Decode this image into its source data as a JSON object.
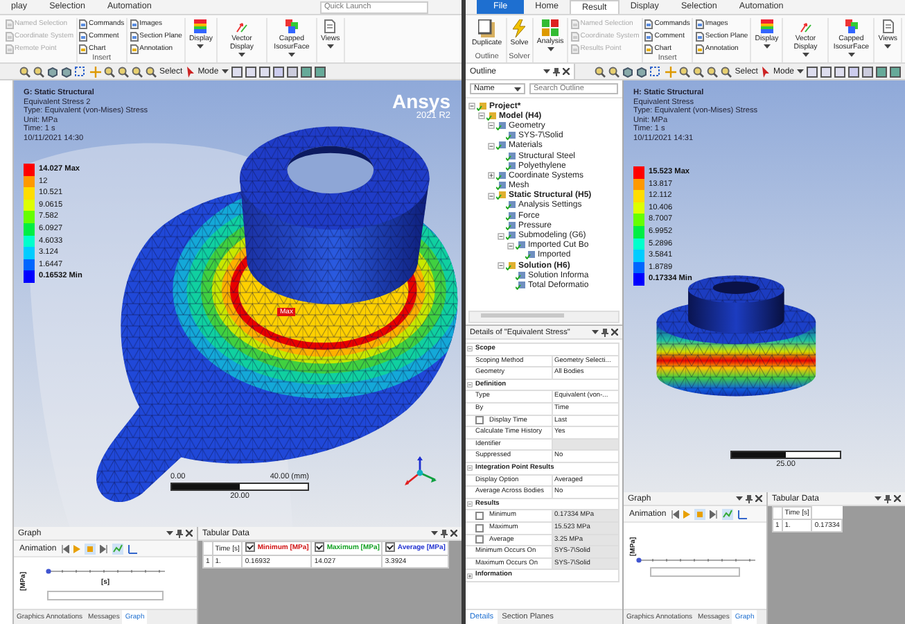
{
  "left_window": {
    "tabs": [
      {
        "label": "play",
        "kind": "tab",
        "selected": false
      },
      {
        "label": "Selection",
        "kind": "tab",
        "selected": false
      },
      {
        "label": "Automation",
        "kind": "tab",
        "selected": false
      }
    ],
    "quick_launch": {
      "placeholder": "Quick Launch"
    },
    "ribbon": [
      {
        "kind": "stack",
        "items": [
          {
            "label": "Named Selection",
            "disabled": true
          },
          {
            "label": "Coordinate System",
            "disabled": true
          },
          {
            "label": "Remote Point",
            "disabled": true
          }
        ]
      },
      {
        "kind": "stack",
        "group": "Insert",
        "items": [
          {
            "label": "Commands",
            "disabled": false
          },
          {
            "label": "Comment",
            "disabled": false
          },
          {
            "label": "Chart",
            "disabled": false
          }
        ]
      },
      {
        "kind": "stack",
        "items": [
          {
            "label": "Images",
            "disabled": false
          },
          {
            "label": "Section Plane",
            "disabled": false
          },
          {
            "label": "Annotation",
            "disabled": false
          }
        ]
      },
      {
        "kind": "contour",
        "label": "Display"
      },
      {
        "kind": "vector",
        "label": "Vector Display"
      },
      {
        "kind": "capped",
        "label": "Capped IsosurFace"
      },
      {
        "kind": "views",
        "label": "Views"
      }
    ],
    "toolbar": {
      "select": "Select",
      "mode": "Mode"
    },
    "viewport": {
      "kind": "flange",
      "header": [
        "G: Static Structural",
        "Equivalent Stress 2",
        "Type: Equivalent (von-Mises) Stress",
        "Unit: MPa",
        "Time: 1 s",
        "10/11/2021 14:30"
      ],
      "legend": [
        {
          "value": "14.027 Max",
          "color": "#ff0000"
        },
        {
          "value": "12",
          "color": "#ff9900"
        },
        {
          "value": "10.521",
          "color": "#ffdd00"
        },
        {
          "value": "9.0615",
          "color": "#ddff00"
        },
        {
          "value": "7.582",
          "color": "#66ff00"
        },
        {
          "value": "6.0927",
          "color": "#00ee44"
        },
        {
          "value": "4.6033",
          "color": "#00ffcc"
        },
        {
          "value": "3.124",
          "color": "#00ccff"
        },
        {
          "value": "1.6447",
          "color": "#0066ff"
        },
        {
          "value": "0.16532 Min",
          "color": "#0000ff"
        }
      ],
      "logo": {
        "name": "Ansys",
        "version": "2021 R2"
      },
      "max_label": "Max",
      "scale": {
        "start": "0.00",
        "end": "40.00 (mm)",
        "middle": "20.00"
      },
      "triad": true
    },
    "graph": {
      "title": "Graph",
      "animation": "Animation",
      "y_unit": "[MPa]",
      "x_unit": "[s]",
      "tabs": [
        {
          "label": "Graphics Annotations",
          "selected": false
        },
        {
          "label": "Messages",
          "selected": false
        },
        {
          "label": "Graph",
          "selected": true
        }
      ]
    },
    "tabular": {
      "title": "Tabular Data",
      "columns": [
        {
          "kind": "plain",
          "label": "Time [s]"
        },
        {
          "kind": "series",
          "label": "Minimum [MPa]",
          "checked": true,
          "color": "#d01010"
        },
        {
          "kind": "series",
          "label": "Maximum [MPa]",
          "checked": true,
          "color": "#10a020"
        },
        {
          "kind": "series",
          "label": "Average [MPa]",
          "checked": true,
          "color": "#2030d0"
        }
      ],
      "rows": [
        {
          "index": "1",
          "cells": [
            "1.",
            "0.16932",
            "14.027",
            "3.3924"
          ]
        }
      ]
    }
  },
  "right_window": {
    "tabs": [
      {
        "label": "File",
        "kind": "file",
        "selected": false
      },
      {
        "label": "Home",
        "kind": "tab",
        "selected": false
      },
      {
        "label": "Result",
        "kind": "tab",
        "selected": true
      },
      {
        "label": "Display",
        "kind": "tab",
        "selected": false
      },
      {
        "label": "Selection",
        "kind": "tab",
        "selected": false
      },
      {
        "label": "Automation",
        "kind": "tab",
        "selected": false
      }
    ],
    "ribbon": [
      {
        "kind": "duplicate",
        "label": "Duplicate",
        "group": "Outline"
      },
      {
        "kind": "solve",
        "label": "Solve",
        "group": "Solver"
      },
      {
        "kind": "analysis",
        "label": "Analysis"
      },
      {
        "kind": "stack",
        "items": [
          {
            "label": "Named Selection",
            "disabled": true
          },
          {
            "label": "Coordinate System",
            "disabled": true
          },
          {
            "label": "Results Point",
            "disabled": true
          }
        ]
      },
      {
        "kind": "stack",
        "group": "Insert",
        "items": [
          {
            "label": "Commands",
            "disabled": false
          },
          {
            "label": "Comment",
            "disabled": false
          },
          {
            "label": "Chart",
            "disabled": false
          }
        ]
      },
      {
        "kind": "stack",
        "items": [
          {
            "label": "Images",
            "disabled": false
          },
          {
            "label": "Section Plane",
            "disabled": false
          },
          {
            "label": "Annotation",
            "disabled": false
          }
        ]
      },
      {
        "kind": "contour",
        "label": "Display"
      },
      {
        "kind": "vector",
        "label": "Vector Display"
      },
      {
        "kind": "capped",
        "label": "Capped IsosurFace"
      },
      {
        "kind": "views",
        "label": "Views"
      }
    ],
    "toolbar": {
      "outline_title": "Outline",
      "select": "Select",
      "mode": "Mode"
    },
    "outline": {
      "sort": "Name",
      "search": {
        "placeholder": "Search Outline"
      },
      "tree": [
        {
          "label": "Project*",
          "bold": true,
          "expanded": true,
          "children": [
            {
              "label": "Model (H4)",
              "bold": true,
              "expanded": true,
              "children": [
                {
                  "label": "Geometry",
                  "bold": false,
                  "expanded": true,
                  "children": [
                    {
                      "label": "SYS-7\\Solid",
                      "bold": false
                    }
                  ]
                },
                {
                  "label": "Materials",
                  "bold": false,
                  "expanded": true,
                  "children": [
                    {
                      "label": "Structural Steel",
                      "bold": false
                    },
                    {
                      "label": "Polyethylene",
                      "bold": false
                    }
                  ]
                },
                {
                  "label": "Coordinate Systems",
                  "bold": false,
                  "expanded": false
                },
                {
                  "label": "Mesh",
                  "bold": false
                },
                {
                  "label": "Static Structural (H5)",
                  "bold": true,
                  "expanded": true,
                  "children": [
                    {
                      "label": "Analysis Settings",
                      "bold": false
                    },
                    {
                      "label": "Force",
                      "bold": false
                    },
                    {
                      "label": "Pressure",
                      "bold": false
                    },
                    {
                      "label": "Submodeling (G6)",
                      "bold": false,
                      "expanded": true,
                      "children": [
                        {
                          "label": "Imported Cut Bo",
                          "bold": false,
                          "expanded": true,
                          "children": [
                            {
                              "label": "Imported",
                              "bold": false
                            }
                          ]
                        }
                      ]
                    },
                    {
                      "label": "Solution (H6)",
                      "bold": true,
                      "expanded": true,
                      "children": [
                        {
                          "label": "Solution Informa",
                          "bold": false
                        },
                        {
                          "label": "Total Deformatio",
                          "bold": false
                        }
                      ]
                    }
                  ]
                }
              ]
            }
          ]
        }
      ]
    },
    "details": {
      "title": "Details of \"Equivalent Stress\"",
      "rows": [
        {
          "kind": "section",
          "label": "Scope",
          "expanded": true
        },
        {
          "kind": "property",
          "label": "Scoping Method",
          "value": "Geometry Selecti...",
          "readonly": false
        },
        {
          "kind": "property",
          "label": "Geometry",
          "value": "All Bodies",
          "readonly": false
        },
        {
          "kind": "section",
          "label": "Definition",
          "expanded": true
        },
        {
          "kind": "property",
          "label": "Type",
          "value": "Equivalent (von-...",
          "readonly": false
        },
        {
          "kind": "property",
          "label": "By",
          "value": "Time",
          "readonly": false
        },
        {
          "kind": "parameter",
          "label": "Display Time",
          "value": "Last",
          "checked": false,
          "readonly": false
        },
        {
          "kind": "property",
          "label": "Calculate Time History",
          "value": "Yes",
          "readonly": false
        },
        {
          "kind": "property",
          "label": "Identifier",
          "value": "",
          "readonly": true
        },
        {
          "kind": "property",
          "label": "Suppressed",
          "value": "No",
          "readonly": false
        },
        {
          "kind": "section",
          "label": "Integration Point Results",
          "expanded": true
        },
        {
          "kind": "property",
          "label": "Display Option",
          "value": "Averaged",
          "readonly": false
        },
        {
          "kind": "property",
          "label": "Average Across Bodies",
          "value": "No",
          "readonly": false
        },
        {
          "kind": "section",
          "label": "Results",
          "expanded": true
        },
        {
          "kind": "parameter",
          "label": "Minimum",
          "value": "0.17334 MPa",
          "checked": false,
          "readonly": true
        },
        {
          "kind": "parameter",
          "label": "Maximum",
          "value": "15.523 MPa",
          "checked": false,
          "readonly": true
        },
        {
          "kind": "parameter",
          "label": "Average",
          "value": "3.25 MPa",
          "checked": false,
          "readonly": true
        },
        {
          "kind": "property",
          "label": "Minimum Occurs On",
          "value": "SYS-7\\Solid",
          "readonly": true
        },
        {
          "kind": "property",
          "label": "Maximum Occurs On",
          "value": "SYS-7\\Solid",
          "readonly": true
        },
        {
          "kind": "section",
          "label": "Information",
          "expanded": false
        }
      ],
      "tabs": [
        {
          "label": "Details",
          "selected": true
        },
        {
          "label": "Section Planes",
          "selected": false
        }
      ]
    },
    "viewport": {
      "kind": "cylinder",
      "header": [
        "H: Static Structural",
        "Equivalent Stress",
        "Type: Equivalent (von-Mises) Stress",
        "Unit: MPa",
        "Time: 1 s",
        "10/11/2021 14:31"
      ],
      "legend": [
        {
          "value": "15.523 Max",
          "color": "#ff0000"
        },
        {
          "value": "13.817",
          "color": "#ff9900"
        },
        {
          "value": "12.112",
          "color": "#ffdd00"
        },
        {
          "value": "10.406",
          "color": "#ddff00"
        },
        {
          "value": "8.7007",
          "color": "#66ff00"
        },
        {
          "value": "6.9952",
          "color": "#00ee44"
        },
        {
          "value": "5.2896",
          "color": "#00ffcc"
        },
        {
          "value": "3.5841",
          "color": "#00ccff"
        },
        {
          "value": "1.8789",
          "color": "#0066ff"
        },
        {
          "value": "0.17334 Min",
          "color": "#0000ff"
        }
      ],
      "scale": {
        "middle": "25.00"
      }
    },
    "graph": {
      "title": "Graph",
      "animation": "Animation",
      "y_unit": "[MPa]",
      "tabs": [
        {
          "label": "Graphics Annotations",
          "selected": false
        },
        {
          "label": "Messages",
          "selected": false
        },
        {
          "label": "Graph",
          "selected": true
        }
      ]
    },
    "tabular": {
      "title": "Tabular Data",
      "columns": [
        {
          "kind": "plain",
          "label": "Time [s]"
        }
      ],
      "rows": [
        {
          "index": "1",
          "cells": [
            "1.",
            "0.17334"
          ]
        }
      ]
    }
  }
}
